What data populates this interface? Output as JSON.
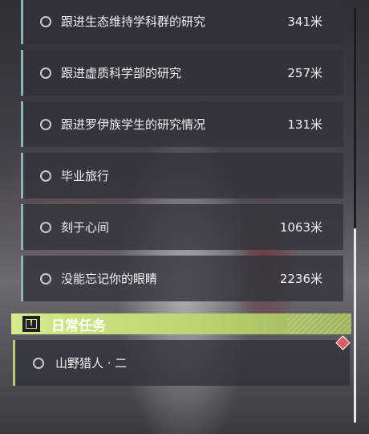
{
  "quests": [
    {
      "title": "跟进生态维持学科群的研究",
      "distance": "341米"
    },
    {
      "title": "跟进虚质科学部的研究",
      "distance": "257米"
    },
    {
      "title": "跟进罗伊族学生的研究情况",
      "distance": "131米"
    },
    {
      "title": "毕业旅行",
      "distance": ""
    },
    {
      "title": "刻于心间",
      "distance": "1063米"
    },
    {
      "title": "没能忘记你的眼睛",
      "distance": "2236米"
    }
  ],
  "daily": {
    "header_label": "日常任务",
    "quest_title": "山野猎人 · 二"
  },
  "colors": {
    "quest_accent": "#8fb3b4",
    "daily_accent": "#d4ec8a",
    "marker": "#e05a66"
  },
  "scrollbar": {
    "position_fraction": 1.0
  }
}
